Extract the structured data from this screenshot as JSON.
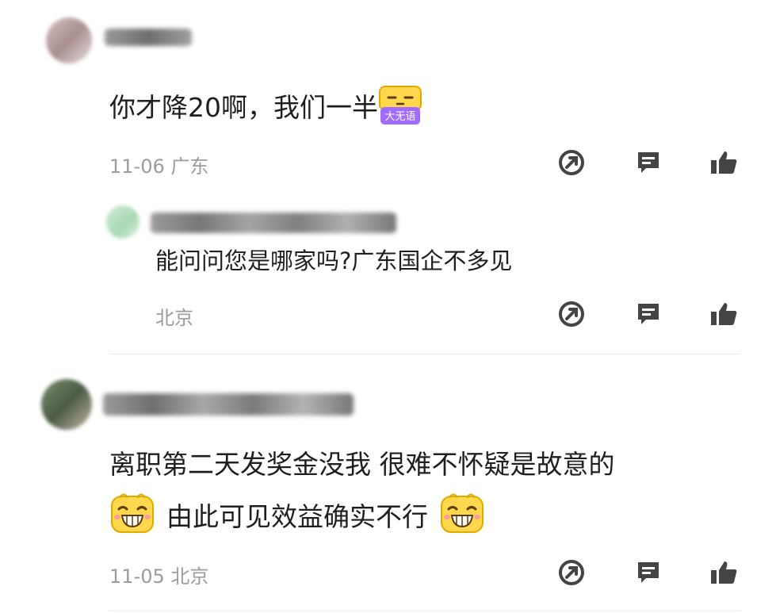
{
  "comments": [
    {
      "text": "你才降20啊，我们一半",
      "sticker_label": "大无语",
      "meta": "11-06 广东",
      "reply": {
        "text": "能问问您是哪家吗?广东国企不多见",
        "meta": "北京"
      }
    },
    {
      "line1": "离职第二天发奖金没我 很难不怀疑是故意的",
      "line2": "由此可见效益确实不行",
      "meta": "11-05 北京"
    }
  ],
  "colors": {
    "meta_text": "#9c9c9c",
    "icon": "#444444",
    "sticker_yellow": "#ffd84d",
    "sticker_purple": "#a16bff"
  },
  "icons": [
    "share-icon",
    "comment-icon",
    "like-icon"
  ]
}
